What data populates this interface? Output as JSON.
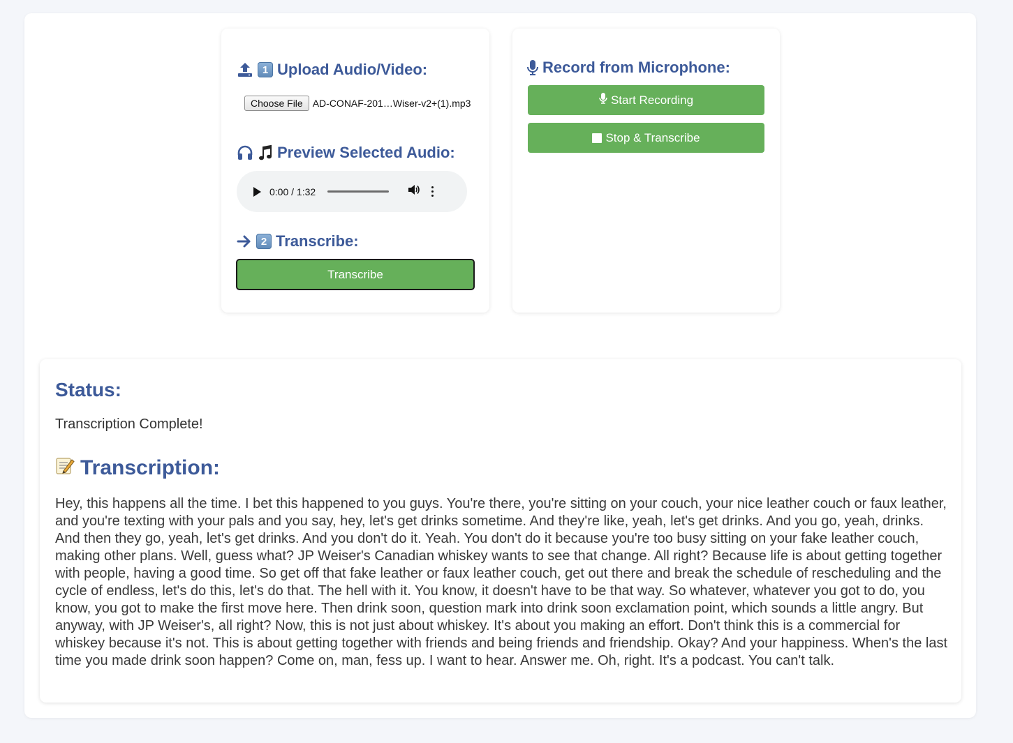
{
  "upload": {
    "number": "1",
    "heading": "Upload Audio/Video:",
    "choose_file_label": "Choose File",
    "file_name": "AD-CONAF-201…Wiser-v2+(1).mp3"
  },
  "preview": {
    "heading": "Preview Selected Audio:",
    "time": "0:00 / 1:32"
  },
  "transcribe": {
    "number": "2",
    "heading": "Transcribe:",
    "button_label": "Transcribe"
  },
  "record": {
    "heading": "Record from Microphone:",
    "start_label": "Start Recording",
    "stop_label": "Stop & Transcribe"
  },
  "status": {
    "title": "Status:",
    "text": "Transcription Complete!"
  },
  "transcription": {
    "heading": "Transcription:",
    "text": "Hey, this happens all the time. I bet this happened to you guys. You're there, you're sitting on your couch, your nice leather couch or faux leather, and you're texting with your pals and you say, hey, let's get drinks sometime. And they're like, yeah, let's get drinks. And you go, yeah, drinks. And then they go, yeah, let's get drinks. And you don't do it. Yeah. You don't do it because you're too busy sitting on your fake leather couch, making other plans. Well, guess what? JP Weiser's Canadian whiskey wants to see that change. All right? Because life is about getting together with people, having a good time. So get off that fake leather or faux leather couch, get out there and break the schedule of rescheduling and the cycle of endless, let's do this, let's do that. The hell with it. You know, it doesn't have to be that way. So whatever, whatever you got to do, you know, you got to make the first move here. Then drink soon, question mark into drink soon exclamation point, which sounds a little angry. But anyway, with JP Weiser's, all right? Now, this is not just about whiskey. It's about you making an effort. Don't think this is a commercial for whiskey because it's not. This is about getting together with friends and being friends and friendship. Okay? And your happiness. When's the last time you made drink soon happen? Come on, man, fess up. I want to hear. Answer me. Oh, right. It's a podcast. You can't talk."
  },
  "colors": {
    "accent": "#3d5a99",
    "button_green": "#66b05a",
    "page_bg": "#f4f6fa"
  },
  "icons": [
    "upload-icon",
    "headphones-icon",
    "music-note-icon",
    "arrow-right-icon",
    "microphone-icon",
    "stop-icon",
    "memo-icon",
    "play-icon",
    "volume-icon",
    "more-options-icon"
  ]
}
